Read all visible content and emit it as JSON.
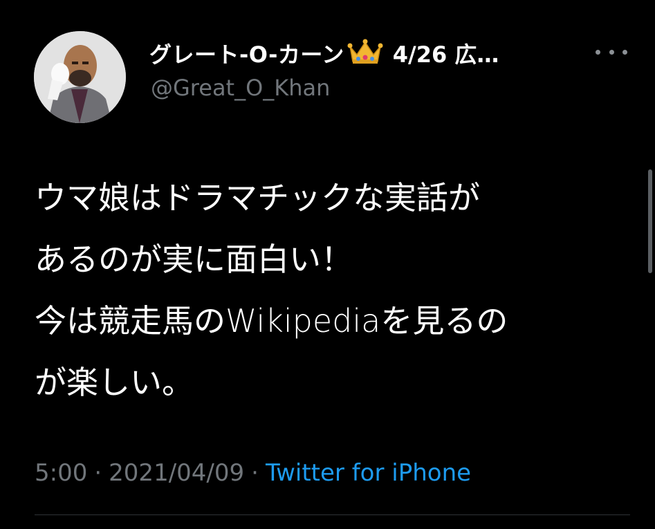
{
  "tweet": {
    "display_name": "グレート-O-カーン",
    "name_badge_icon": "crown-icon",
    "meta": "4/26 広…",
    "handle": "@Great_O_Khan",
    "text_lines": [
      "ウマ娘はドラマチックな実話が",
      "あるのが実に面白い！",
      "今は競走馬のWikipediaを見るの",
      "が楽しい。"
    ],
    "time": "5:00",
    "date": "2021/04/09",
    "separator": "·",
    "source": "Twitter for iPhone"
  },
  "colors": {
    "background": "#000000",
    "primary_text": "#ffffff",
    "secondary_text": "#71767b",
    "link": "#1d9bf0"
  }
}
